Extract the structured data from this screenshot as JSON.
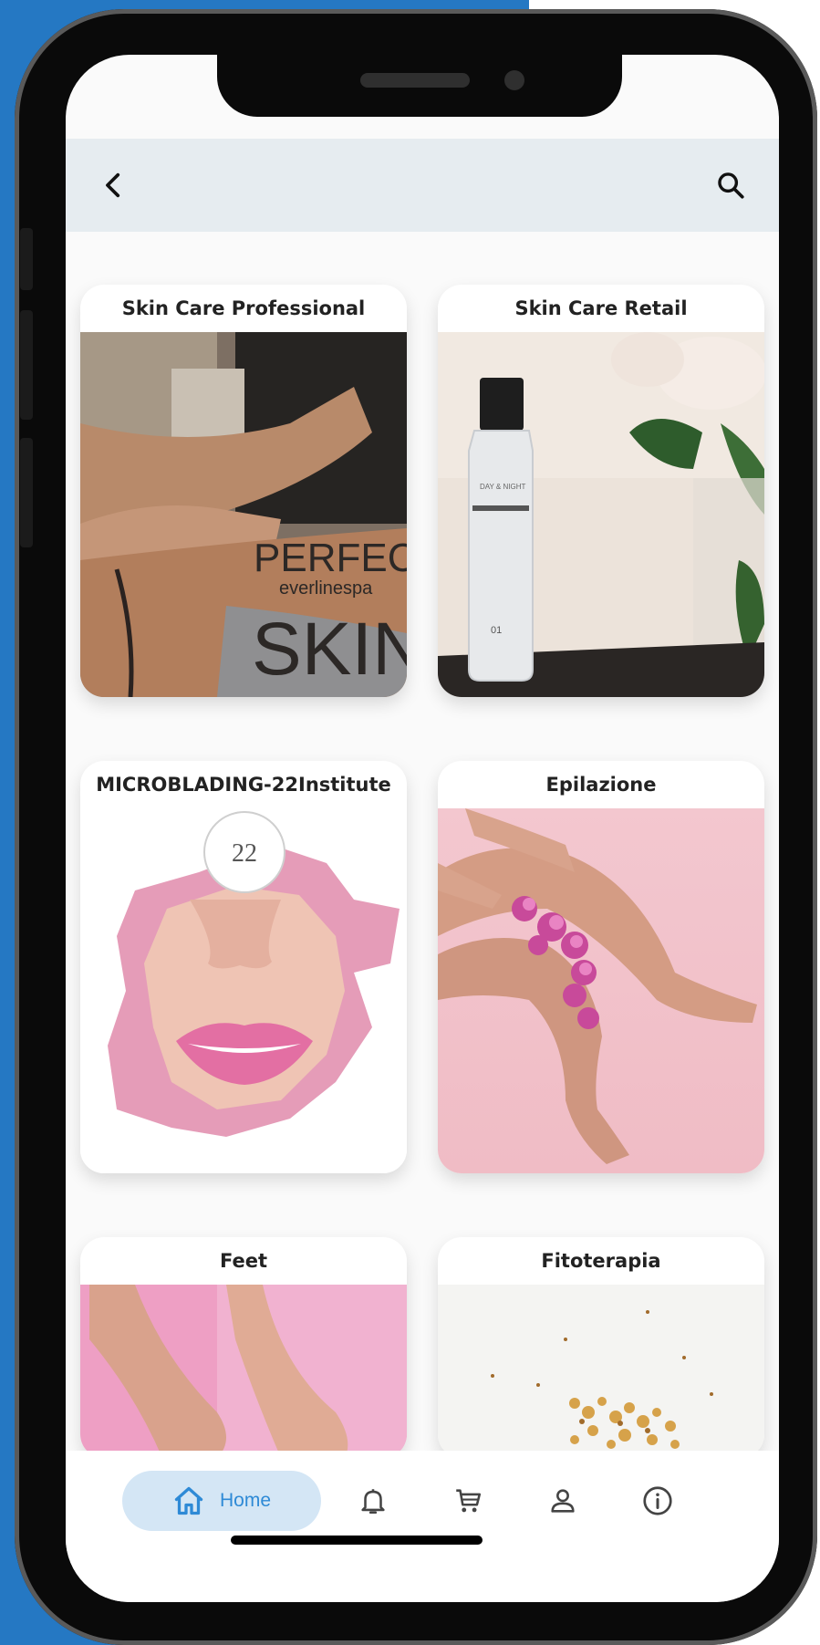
{
  "header": {
    "back_icon": "chevron-left-icon",
    "search_icon": "search-icon"
  },
  "categories": [
    {
      "title": "Skin Care Professional",
      "image": "spa-massage-photo",
      "overlay_text": [
        "PERFECT",
        "everlinespa",
        "SKIN"
      ]
    },
    {
      "title": "Skin Care Retail",
      "image": "cleansing-bottle-photo",
      "overlay_text": [
        "DAY & NIGHT",
        "01"
      ]
    },
    {
      "title": "MICROBLADING-22Institute",
      "image": "lips-torn-paper-photo",
      "overlay_text": [
        "22"
      ]
    },
    {
      "title": "Epilazione",
      "image": "legs-orchid-photo",
      "overlay_text": []
    },
    {
      "title": "Feet",
      "image": "feet-pink-photo",
      "overlay_text": []
    },
    {
      "title": "Fitoterapia",
      "image": "dried-herbs-photo",
      "overlay_text": []
    }
  ],
  "bottom_nav": {
    "home_label": "Home",
    "items": [
      "home-icon",
      "bell-icon",
      "cart-icon",
      "user-icon",
      "info-icon"
    ],
    "active": "Home"
  },
  "colors": {
    "accent": "#2e8ad6",
    "pill_bg": "#d4e6f5",
    "header_bg": "#e6ecf0",
    "side_bg": "#2578c3"
  }
}
